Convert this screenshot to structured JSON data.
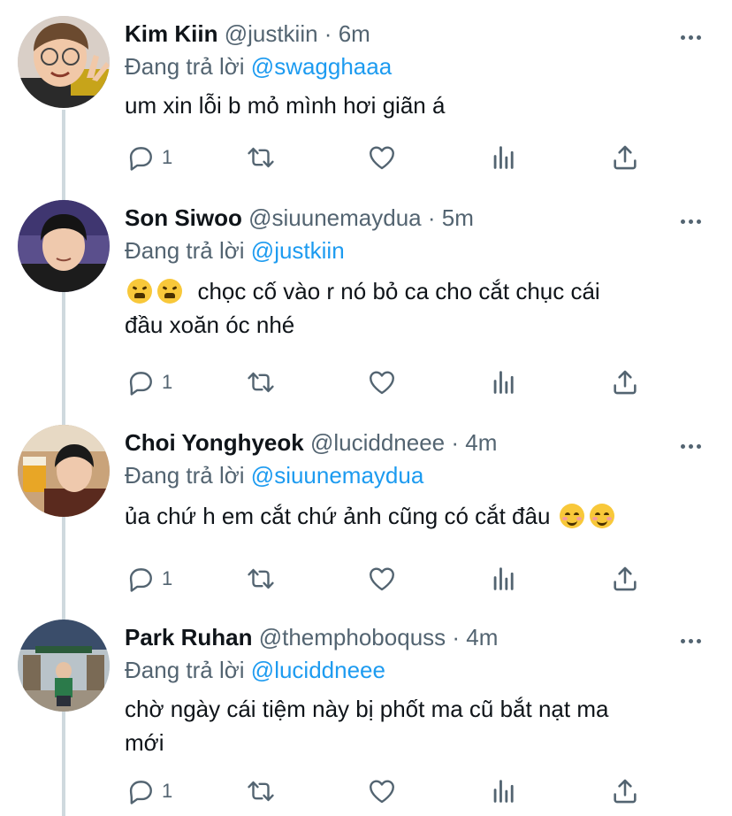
{
  "colors": {
    "accent": "#1d9bf0",
    "muted": "#536471",
    "text": "#0f1419",
    "thread_line": "#cfd9de"
  },
  "tweets": [
    {
      "name": "Kim Kiin",
      "handle": "@justkiin",
      "time": "6m",
      "replying_prefix": "Đang trả lời",
      "replying_to": "@swagghaaa",
      "text": "um xin lỗi b mỏ mình hơi giãn á",
      "reply_count": "1"
    },
    {
      "name": "Son Siwoo",
      "handle": "@siuunemaydua",
      "time": "5m",
      "replying_prefix": "Đang trả lời",
      "replying_to": "@justkiin",
      "text_line1": "chọc cố vào r nó bỏ ca cho cắt chục cái",
      "text_line2": "đầu xoăn óc nhé",
      "reply_count": "1"
    },
    {
      "name": "Choi Yonghyeok",
      "handle": "@luciddneee",
      "time": "4m",
      "replying_prefix": "Đang trả lời",
      "replying_to": "@siuunemaydua",
      "text": "ủa chứ h em cắt chứ ảnh cũng có cắt đâu",
      "reply_count": "1"
    },
    {
      "name": "Park Ruhan",
      "handle": "@themphoboquss",
      "time": "4m",
      "replying_prefix": "Đang trả lời",
      "replying_to": "@luciddneee",
      "text_line1": "chờ ngày cái tiệm này bị phốt ma cũ bắt nạt ma",
      "text_line2": "mới",
      "reply_count": "1"
    }
  ],
  "separator": "·",
  "icons": [
    "reply-icon",
    "retweet-icon",
    "like-icon",
    "views-icon",
    "share-icon",
    "more-icon"
  ]
}
